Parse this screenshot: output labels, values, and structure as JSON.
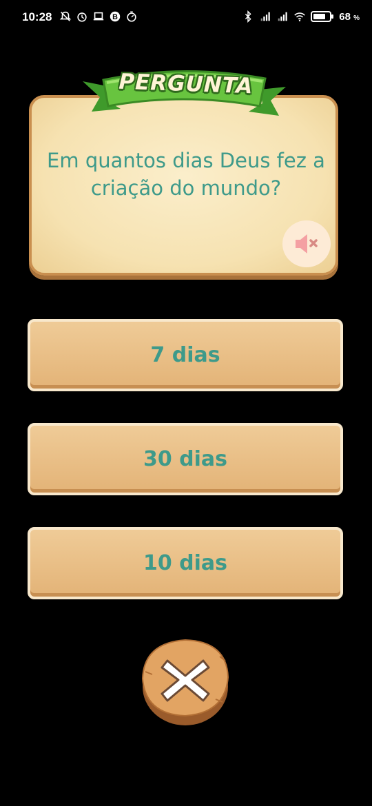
{
  "status_bar": {
    "time": "10:28",
    "left_icons": [
      "notification-off-icon",
      "alarm-icon",
      "laptop-icon",
      "b-badge-icon",
      "timer-icon"
    ],
    "right_icons": [
      "bluetooth-icon",
      "signal-icon",
      "signal-icon",
      "wifi-icon",
      "battery-icon"
    ],
    "battery_percent": "68",
    "battery_unit": "%"
  },
  "card": {
    "banner_label": "PERGUNTA",
    "question": "Em quantos dias Deus fez a criação do mundo?",
    "mute_icon": "speaker-muted-icon"
  },
  "answers": [
    {
      "label": "7 dias"
    },
    {
      "label": "30 dias"
    },
    {
      "label": "10 dias"
    }
  ],
  "close_button": {
    "icon": "close-icon"
  },
  "colors": {
    "background": "#000000",
    "card": "#f6e2b1",
    "card_border": "#c98f4f",
    "banner_green": "#5dbb3a",
    "text_teal": "#3e9a8a",
    "answer_fill": "#e8bd84",
    "close_wood": "#e2a463"
  }
}
